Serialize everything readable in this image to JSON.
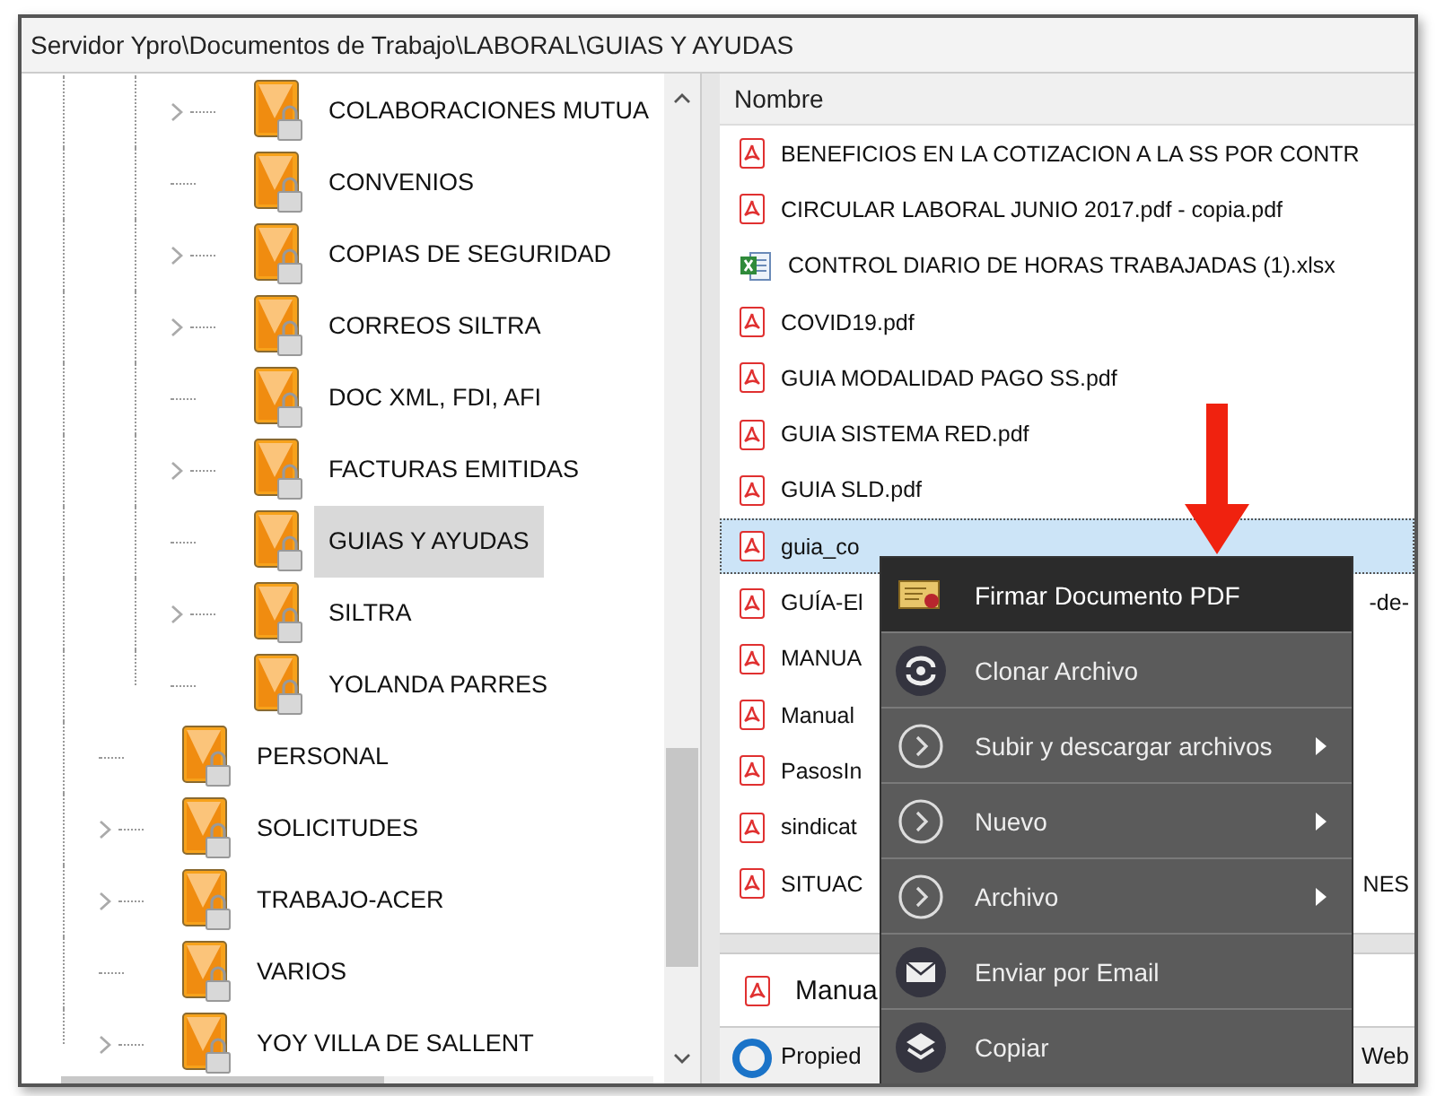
{
  "path_bar": {
    "text": "Servidor Ypro\\Documentos de Trabajo\\LABORAL\\GUIAS Y AYUDAS"
  },
  "tree": {
    "nested_items": [
      {
        "label": "COLABORACIONES MUTUA",
        "expandable": true,
        "selected": false
      },
      {
        "label": "CONVENIOS",
        "expandable": false,
        "selected": false
      },
      {
        "label": "COPIAS DE SEGURIDAD",
        "expandable": true,
        "selected": false
      },
      {
        "label": "CORREOS SILTRA",
        "expandable": true,
        "selected": false
      },
      {
        "label": "DOC XML, FDI, AFI",
        "expandable": false,
        "selected": false
      },
      {
        "label": "FACTURAS EMITIDAS",
        "expandable": true,
        "selected": false
      },
      {
        "label": "GUIAS Y AYUDAS",
        "expandable": false,
        "selected": true
      },
      {
        "label": "SILTRA",
        "expandable": true,
        "selected": false
      },
      {
        "label": "YOLANDA PARRES",
        "expandable": false,
        "selected": false
      }
    ],
    "items": [
      {
        "label": "PERSONAL",
        "expandable": false,
        "selected": false
      },
      {
        "label": "SOLICITUDES",
        "expandable": true,
        "selected": false
      },
      {
        "label": "TRABAJO-ACER",
        "expandable": true,
        "selected": false
      },
      {
        "label": "VARIOS",
        "expandable": false,
        "selected": false
      },
      {
        "label": "YOY VILLA DE SALLENT",
        "expandable": true,
        "selected": false
      }
    ]
  },
  "file_list": {
    "column": "Nombre",
    "rows": [
      {
        "kind": "pdf",
        "name": "BENEFICIOS EN LA COTIZACION A LA SS POR CONTR",
        "selected": false
      },
      {
        "kind": "pdf",
        "name": "CIRCULAR LABORAL JUNIO 2017.pdf - copia.pdf",
        "selected": false
      },
      {
        "kind": "xlsx",
        "name": "CONTROL DIARIO DE HORAS TRABAJADAS (1).xlsx",
        "selected": false
      },
      {
        "kind": "pdf",
        "name": "COVID19.pdf",
        "selected": false
      },
      {
        "kind": "pdf",
        "name": "GUIA MODALIDAD PAGO SS.pdf",
        "selected": false
      },
      {
        "kind": "pdf",
        "name": "GUIA SISTEMA RED.pdf",
        "selected": false
      },
      {
        "kind": "pdf",
        "name": "GUIA SLD.pdf",
        "selected": false
      },
      {
        "kind": "pdf",
        "name": "guia_co",
        "selected": true
      },
      {
        "kind": "pdf",
        "name": "GUÍA-El",
        "tail": "-de-",
        "selected": false
      },
      {
        "kind": "pdf",
        "name": "MANUA",
        "selected": false
      },
      {
        "kind": "pdf",
        "name": "Manual",
        "selected": false
      },
      {
        "kind": "pdf",
        "name": "PasosIn",
        "selected": false
      },
      {
        "kind": "pdf",
        "name": "sindicat",
        "selected": false
      },
      {
        "kind": "pdf",
        "name": "SITUAC",
        "tail": "NES",
        "selected": false
      }
    ]
  },
  "preview_panel": {
    "file": "Manua"
  },
  "bottom_toolbar": {
    "left": "Propied",
    "right": "Web"
  },
  "context_menu": {
    "items": [
      {
        "label": "Firmar Documento PDF",
        "highlighted": true,
        "submenu": false
      },
      {
        "label": "Clonar Archivo",
        "highlighted": false,
        "submenu": false
      },
      {
        "label": "Subir y descargar archivos",
        "highlighted": false,
        "submenu": true
      },
      {
        "label": "Nuevo",
        "highlighted": false,
        "submenu": true
      },
      {
        "label": "Archivo",
        "highlighted": false,
        "submenu": true
      },
      {
        "label": "Enviar por Email",
        "highlighted": false,
        "submenu": false
      },
      {
        "label": "Copiar",
        "highlighted": false,
        "submenu": false
      }
    ]
  }
}
